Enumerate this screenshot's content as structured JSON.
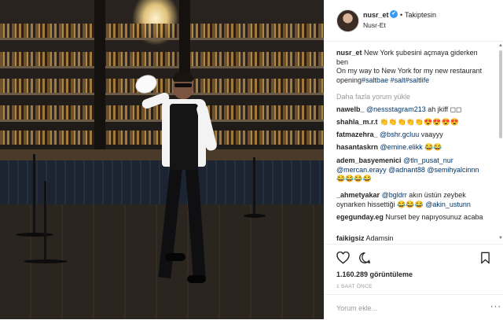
{
  "header": {
    "username": "nusr_et",
    "verified_icon": "✔",
    "separator": "•",
    "follow_label": "Takiptesin",
    "location": "Nusr-Et"
  },
  "caption": {
    "username": "nusr_et",
    "text_tr": "New York şubesini açmaya giderken ben",
    "text_en": "On my way to New York for my new restaurant opening",
    "hashtags": "#saltbae #salt#saltlife"
  },
  "load_more": "Daha fazla yorum yükle",
  "comments": [
    {
      "user": "nawelb_",
      "mentions": "@nessstagram213",
      "text": "ah jkiff ◻◻"
    },
    {
      "user": "shahla_m.r.t",
      "mentions": "",
      "text": "👏👏👏👏👏😍😍😍😍"
    },
    {
      "user": "fatmazehra_",
      "mentions": "@bshr.gcluu",
      "text": "vaayyy"
    },
    {
      "user": "hasantaskrn",
      "mentions": "@emine.elikk",
      "text": "😂😂"
    },
    {
      "user": "adem_basyemenici",
      "mentions": "@tln_pusat_nur @mercan.erayy @adnant88 @semihyalcinnn",
      "text": "😂😂😂😂"
    },
    {
      "user": "_ahmetyakar",
      "mentions": "@bgldrr",
      "text": "akın üstün zeybek oynarken hissettiği 😂😂😂",
      "mention2": "@akin_ustunn"
    },
    {
      "user": "egegunday.eg",
      "mentions": "",
      "text": "Nurset bey napıyosunuz acaba"
    },
    {
      "user": "faikigsiz",
      "mentions": "",
      "text": "Adamsin"
    }
  ],
  "actions": {
    "like_icon": "heart-icon",
    "comment_icon": "comment-icon",
    "save_icon": "bookmark-icon"
  },
  "views": "1.160.289 görüntüleme",
  "time_ago": "1 SAAT ÖNCE",
  "comment_input": {
    "placeholder": "Yorum ekle..."
  },
  "more_options": "···",
  "colors": {
    "link": "#003569",
    "verified": "#3897f0",
    "muted": "#999999",
    "text": "#262626"
  }
}
